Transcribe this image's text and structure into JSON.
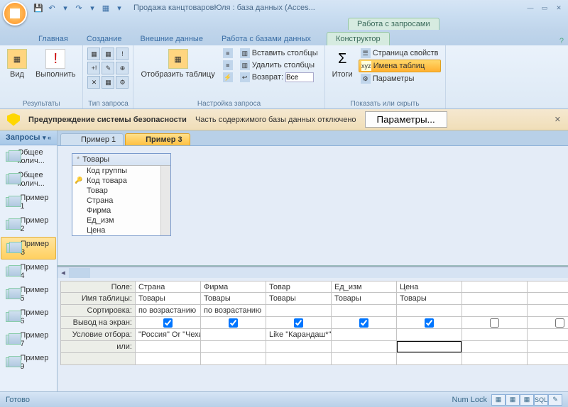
{
  "app": {
    "title": "Продажа канцтоваровЮля : база данных (Acces...",
    "context_tool_title": "Работа с запросами"
  },
  "tabs": {
    "home": "Главная",
    "create": "Создание",
    "external": "Внешние данные",
    "dbtools": "Работа с базами данных",
    "design": "Конструктор"
  },
  "ribbon": {
    "results": {
      "view": "Вид",
      "run": "Выполнить",
      "label": "Результаты"
    },
    "querytype": {
      "label": "Тип запроса"
    },
    "querysetup": {
      "show_table": "Отобразить таблицу",
      "insert_cols": "Вставить столбцы",
      "delete_cols": "Удалить столбцы",
      "return": "Возврат:",
      "return_val": "Все",
      "label": "Настройка запроса"
    },
    "showhide": {
      "totals": "Итоги",
      "property": "Страница свойств",
      "table_names": "Имена таблиц",
      "params": "Параметры",
      "label": "Показать или скрыть"
    }
  },
  "security": {
    "title": "Предупреждение системы безопасности",
    "msg": "Часть содержимого базы данных отключено",
    "btn": "Параметры..."
  },
  "nav": {
    "header": "Запросы",
    "items": [
      "Общее колич...",
      "Общее колич...",
      "Пример 1",
      "Пример 2",
      "Пример 3",
      "Пример 4",
      "Пример 5",
      "Пример 6",
      "Пример 7",
      "Пример 9"
    ]
  },
  "doctabs": {
    "t1": "Пример 1",
    "t2": "Пример 3"
  },
  "fieldlist": {
    "title": "Товары",
    "fields": [
      "Код группы",
      "Код товара",
      "Товар",
      "Страна",
      "Фирма",
      "Ед_изм",
      "Цена"
    ]
  },
  "grid": {
    "rows": [
      "Поле:",
      "Имя таблицы:",
      "Сортировка:",
      "Вывод на экран:",
      "Условие отбора:",
      "или:"
    ],
    "field": [
      "Страна",
      "Фирма",
      "Товар",
      "Ед_изм",
      "Цена",
      ""
    ],
    "table": [
      "Товары",
      "Товары",
      "Товары",
      "Товары",
      "Товары",
      ""
    ],
    "sort": [
      "по возрастанию",
      "по возрастанию",
      "",
      "",
      "",
      ""
    ],
    "show": [
      true,
      true,
      true,
      true,
      true,
      false
    ],
    "crit": [
      "\"Россия\" Or \"Чехия\"",
      "",
      "Like \"Карандаш*\"",
      "",
      "",
      ""
    ],
    "or": [
      "",
      "",
      "",
      "",
      "",
      ""
    ]
  },
  "status": {
    "ready": "Готово",
    "numlock": "Num Lock"
  }
}
